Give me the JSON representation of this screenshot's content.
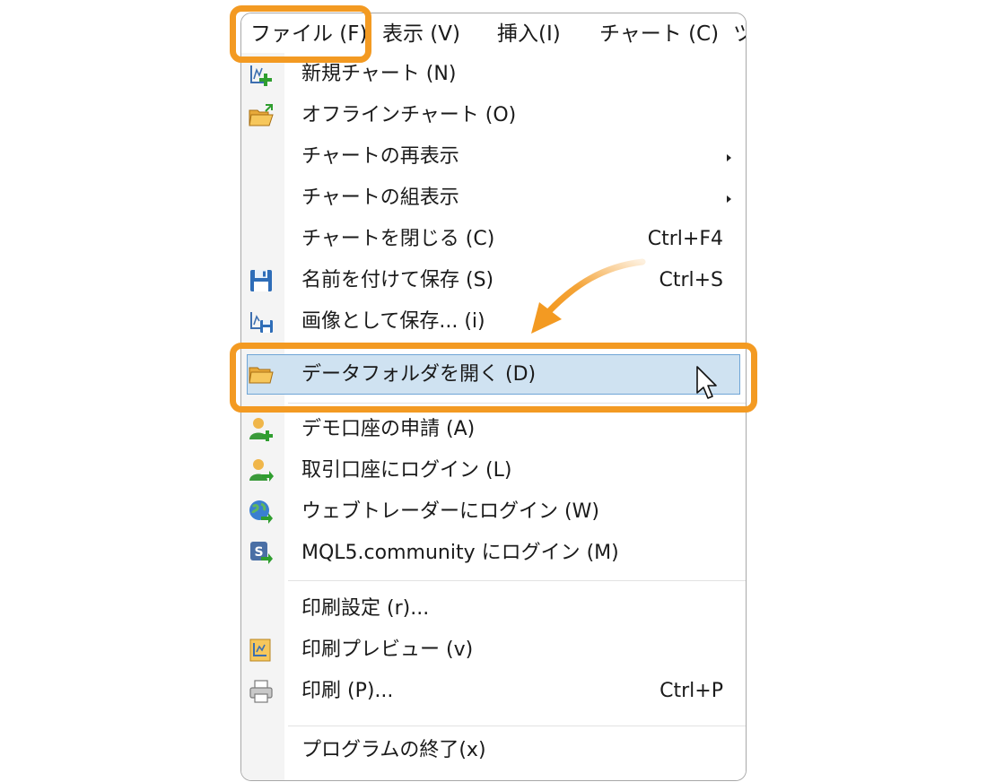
{
  "menubar": {
    "items": [
      {
        "label": "ファイル (F)"
      },
      {
        "label": "表示 (V)"
      },
      {
        "label": "挿入(I)"
      },
      {
        "label": "チャート (C)"
      },
      {
        "label": "ツ"
      }
    ]
  },
  "file_menu": {
    "items": [
      {
        "label": "新規チャート (N)",
        "icon": "new-chart-icon"
      },
      {
        "label": "オフラインチャート (O)",
        "icon": "open-folder-icon"
      },
      {
        "label": "チャートの再表示",
        "has_submenu": true
      },
      {
        "label": "チャートの組表示",
        "has_submenu": true
      },
      {
        "label": "チャートを閉じる (C)",
        "shortcut": "Ctrl+F4"
      },
      {
        "label": "名前を付けて保存 (S)",
        "shortcut": "Ctrl+S",
        "icon": "floppy-disk-icon"
      },
      {
        "label": "画像として保存... (i)",
        "icon": "save-image-icon"
      },
      {
        "label": "データフォルダを開く (D)",
        "icon": "folder-icon",
        "highlighted": true
      },
      {
        "label": "デモ口座の申請 (A)",
        "icon": "user-add-icon"
      },
      {
        "label": "取引口座にログイン (L)",
        "icon": "user-login-icon"
      },
      {
        "label": "ウェブトレーダーにログイン (W)",
        "icon": "globe-login-icon"
      },
      {
        "label": "MQL5.community にログイン (M)",
        "icon": "mql5-login-icon"
      },
      {
        "label": "印刷設定 (r)..."
      },
      {
        "label": "印刷プレビュー (v)",
        "icon": "print-preview-icon"
      },
      {
        "label": "印刷 (P)...",
        "shortcut": "Ctrl+P",
        "icon": "printer-icon"
      },
      {
        "label": "プログラムの終了(x)"
      }
    ]
  },
  "colors": {
    "callout": "#f39a22",
    "highlight_fill": "#cfe2f1",
    "highlight_border": "#6fa5d6"
  }
}
